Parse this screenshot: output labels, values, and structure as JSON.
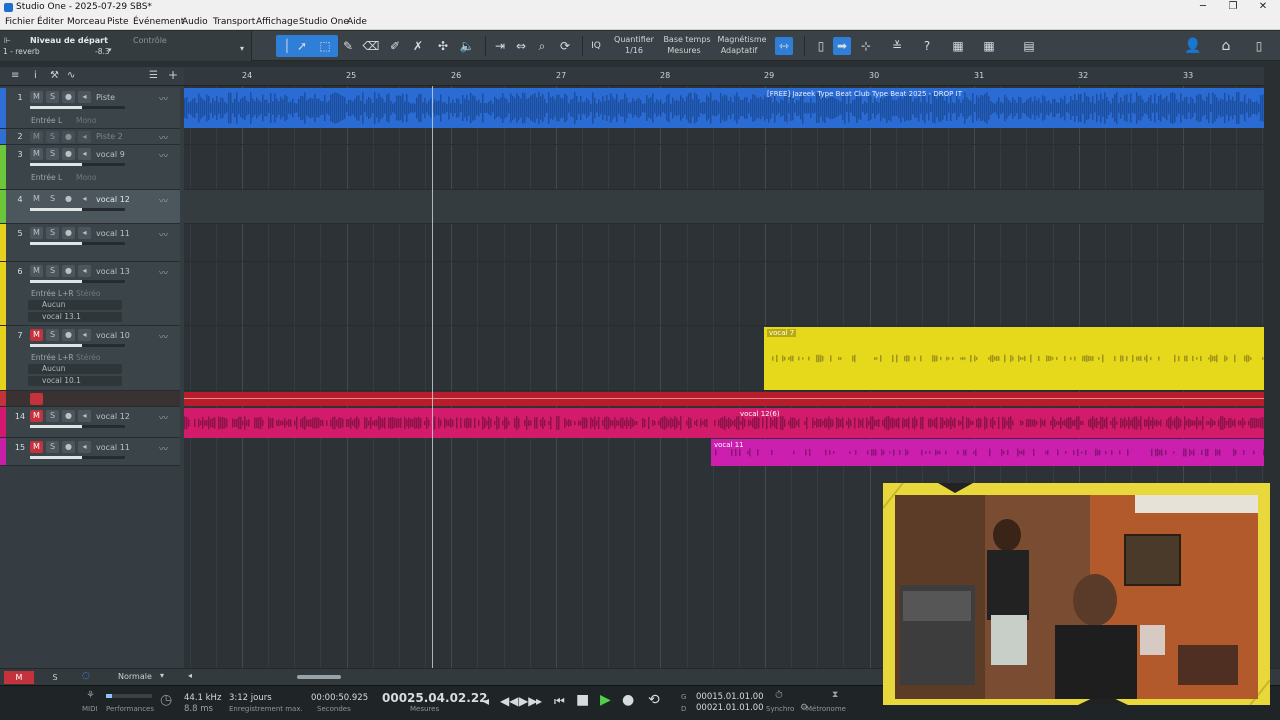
{
  "window": {
    "title": "Studio One - 2025-07-29 SBS*",
    "minimize": "─",
    "maximize": "❐",
    "close": "✕"
  },
  "menu": [
    "Fichier",
    "Éditer",
    "Morceau",
    "Piste",
    "Événement",
    "Audio",
    "Transport",
    "Affichage",
    "Studio One",
    "Aide"
  ],
  "input_panel": {
    "label": "Niveau de départ",
    "source": "1 - reverb",
    "level": "-8.3",
    "control_label": "Contrôle"
  },
  "toolbar": {
    "quantize_label": "Quantifier",
    "quantize_value": "1/16",
    "timebase_label": "Base temps",
    "timebase_value": "Mesures",
    "snap_label": "Magnétisme",
    "snap_value": "Adaptatif",
    "iq": "IQ"
  },
  "ruler": {
    "bars": [
      "24",
      "25",
      "26",
      "27",
      "28",
      "29",
      "30",
      "31",
      "32",
      "33"
    ]
  },
  "tracks": [
    {
      "num": "1",
      "name": "Piste",
      "color": "#2f6fd6",
      "sub1": "Entrée L",
      "sub1b": "Mono"
    },
    {
      "num": "2",
      "name": "Piste 2",
      "color": "#2f6fd6"
    },
    {
      "num": "3",
      "name": "vocal 9",
      "color": "#6cc63a",
      "sub1": "Entrée L",
      "sub1b": "Mono"
    },
    {
      "num": "4",
      "name": "vocal 12",
      "color": "#6cc63a"
    },
    {
      "num": "5",
      "name": "vocal 11",
      "color": "#e6d21c"
    },
    {
      "num": "6",
      "name": "vocal 13",
      "color": "#e6d21c",
      "sub1": "Entrée L+R",
      "sub1b": "Stéréo",
      "sub2": "Aucun",
      "sub3": "vocal 13.1"
    },
    {
      "num": "7",
      "name": "vocal 10",
      "color": "#e6d21c",
      "sub1": "Entrée L+R",
      "sub1b": "Stéréo",
      "sub2": "Aucun",
      "sub3": "vocal 10.1"
    },
    {
      "num": "14",
      "name": "vocal 12",
      "color": "#d4186e"
    },
    {
      "num": "15",
      "name": "vocal 11",
      "color": "#c81fa8"
    }
  ],
  "events": {
    "beat": "[FREE] Jazeek Type Beat  Club Type Beat 2025 - DROP IT",
    "vocal7": "vocal 7",
    "vocal12_6": "vocal 12(6)",
    "vocal11": "vocal 11"
  },
  "bottom_bar": {
    "m": "M",
    "s": "S",
    "mode": "Normale"
  },
  "transport": {
    "midi": "MIDI",
    "performance": "Performances",
    "sample_rate": "44.1 kHz",
    "latency": "8.8 ms",
    "record_max": "3:12 jours",
    "record_max_label": "Enregistrement max.",
    "seconds": "00:00:50.925",
    "seconds_label": "Secondes",
    "position": "00025.04.02.22",
    "position_label": "Mesures",
    "loop_start": "00015.01.01.00",
    "loop_end": "00021.01.01.00",
    "loop_start_tag": "G",
    "loop_end_tag": "D",
    "sync": "Synchro",
    "metronome": "Métronome"
  }
}
